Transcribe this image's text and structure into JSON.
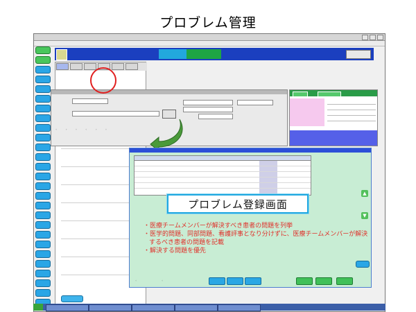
{
  "page": {
    "title": "プロブレム管理"
  },
  "window": {
    "title_text": ""
  },
  "registration_screen": {
    "banner_label": "プロブレム登録画面",
    "bullets": [
      "医療チームメンバーが解決すべき患者の問題を列挙",
      "医学的問題、同部問題、看護評事となり分けずに、医療チームメンバーが解決するべき患者の問題を記載",
      "解決する問題を優先"
    ]
  },
  "colors": {
    "accent_blue": "#2aa6e6",
    "header_blue": "#1b3fbf",
    "green_button": "#49c65c",
    "panel_green": "#c8edd4",
    "bullet_red": "#e0302a",
    "highlight_circle": "#e12020",
    "arrow_green": "#4a9a3a"
  },
  "icons": {
    "arrow": "curved-arrow-icon",
    "highlight": "red-circle-highlight",
    "scroll_up": "up-arrow-icon",
    "scroll_down": "down-arrow-icon"
  }
}
